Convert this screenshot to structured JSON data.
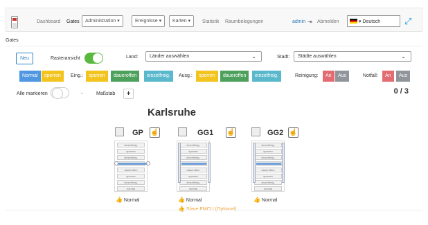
{
  "header": {
    "nav": [
      "Dashboard",
      "Gates"
    ],
    "administration": "Administration ▾",
    "events": "Ereignisse ▾",
    "maps": "Karten ▾",
    "statistics": "Statistik",
    "rooms": "Raumbelegungen",
    "user": "admin",
    "logout": "Abmelden",
    "language": "Deutsch"
  },
  "page": {
    "title": "Gates",
    "new": "Neu",
    "grid_view": "Rasteransicht",
    "country_label": "Land:",
    "country_value": "Länder auswählen",
    "city_label": "Stadt:",
    "city_value": "Städte auswählen",
    "entry": "Eing.:",
    "exit": "Ausg.:",
    "cleaning": "Reinigung:",
    "emergency": "Notfall:",
    "modes": [
      "Normal",
      "sperren"
    ],
    "entry_modes": [
      "sperren",
      "daueroffen",
      "einzelfreig."
    ],
    "exit_modes": [
      "sperren",
      "daueroffen",
      "einzelfreig."
    ],
    "on": "An",
    "off": "Aus",
    "mark_all": "Alle markieren",
    "minus": "−",
    "scale": "Maßstab",
    "plus": "+",
    "count": "0 / 3",
    "city": "Karlsruhe"
  },
  "gates": [
    {
      "name": "GP",
      "status": "Normal",
      "warning": ""
    },
    {
      "name": "GG1",
      "status": "Normal",
      "warning": "Slave FMCU (Optional)"
    },
    {
      "name": "GG2",
      "status": "Normal",
      "warning": ""
    }
  ],
  "lanes": [
    "einzelfreig.",
    "sperren",
    "einzelfreig.",
    "daueroffen",
    "daueroffen",
    "sperren",
    "einzelfreig.",
    "normal"
  ]
}
